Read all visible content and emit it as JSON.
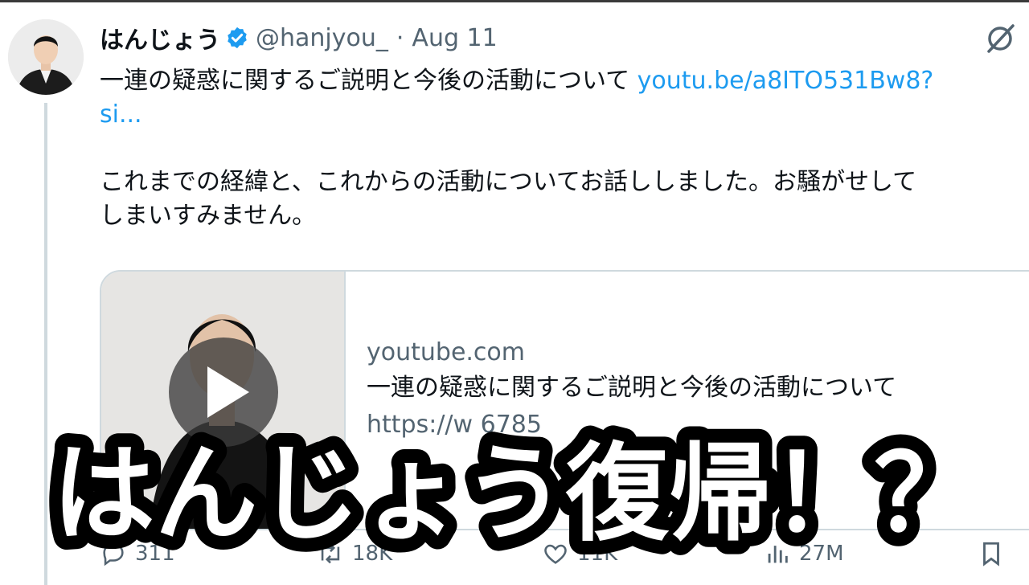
{
  "tweet": {
    "author_name": "はんじょう",
    "handle": "@hanjyou_",
    "separator": "·",
    "date": "Aug 11",
    "text_line1": "一連の疑惑に関するご説明と今後の活動について ",
    "link_text": "youtu.be/a8ITO531Bw8?",
    "link_cont": "si...",
    "text_line3": "これまでの経緯と、これからの活動についてお話ししました。お騒がせして",
    "text_line4": "しまいすみません。"
  },
  "card": {
    "domain": "youtube.com",
    "title": "一連の疑惑に関するご説明と今後の活動について",
    "url": "https://w                      6785"
  },
  "actions": {
    "replies": "311",
    "retweets": "18K",
    "likes": "11K",
    "views": "27M"
  },
  "overlay": {
    "caption": "はんじょう復帰！？"
  },
  "icons": {
    "verified": "verified-badge-icon",
    "grok": "grok-icon",
    "play": "play-icon",
    "reply": "reply-icon",
    "retweet": "retweet-icon",
    "like": "like-icon",
    "views": "views-icon",
    "bookmark": "bookmark-icon"
  },
  "colors": {
    "link": "#1d9bf0",
    "muted": "#536471",
    "text": "#0f1419",
    "caption_fill": "#ffffff",
    "caption_stroke": "#000000"
  }
}
